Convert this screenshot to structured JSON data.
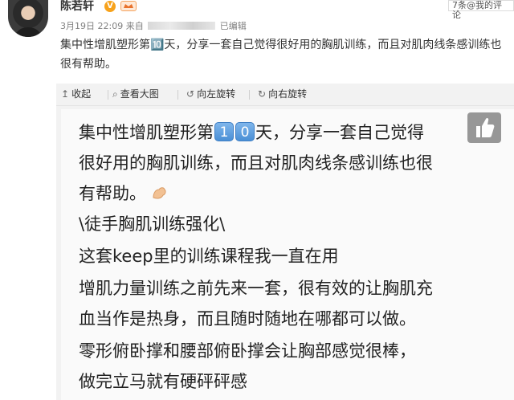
{
  "user": {
    "name": "陈若轩",
    "verified_mark": "V"
  },
  "meta": {
    "date": "3月19日 22:09",
    "source_prefix": "来自",
    "source_suffix": "已编辑"
  },
  "notice": "7条@我的评论",
  "post": {
    "text": "集中性增肌塑形第🔟天，分享一套自己觉得很好用的胸肌训练，而且对肌肉线条感训练也很有帮助。"
  },
  "toolbar": {
    "collapse": "收起",
    "view_large": "查看大图",
    "rotate_left": "向左旋转",
    "rotate_right": "向右旋转"
  },
  "image": {
    "line1_a": "集中性增肌塑形第",
    "digit1": "1",
    "digit2": "0",
    "line1_b": "天，分享一套自己觉得",
    "line2": "很好用的胸肌训练，而且对肌肉线条感训练也很",
    "line3": "有帮助。",
    "line4": "\\徒手胸肌训练强化\\",
    "line5": "这套keep里的训练课程我一直在用",
    "line6": "增肌力量训练之前先来一套，很有效的让胸肌充",
    "line7": "血当作是热身，而且随时随地在哪都可以做。",
    "line8": "零形俯卧撑和腰部俯卧撑会让胸部感觉很棒，",
    "line9": "做完立马就有硬砰砰感"
  },
  "colors": {
    "keycap": "#4a8fd6",
    "verified": "#f7a21b"
  }
}
